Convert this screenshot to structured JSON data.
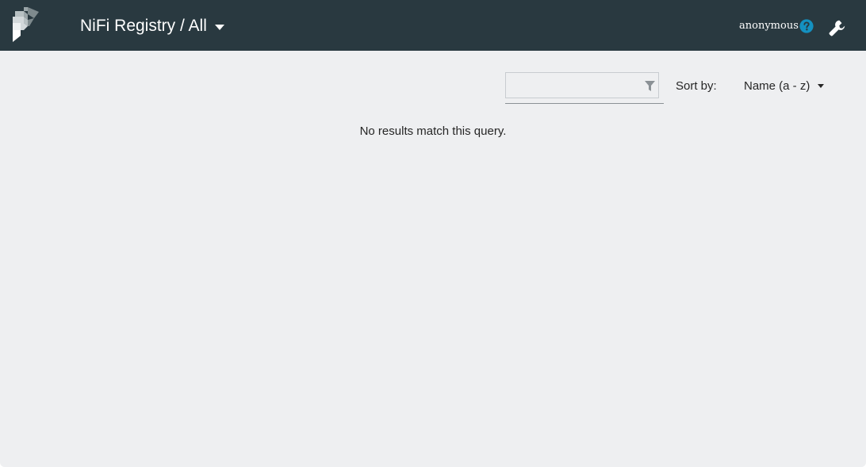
{
  "header": {
    "title": "NiFi Registry / All",
    "user": "anonymous",
    "logo_icon": "nifi-registry-logo-icon",
    "help_icon": "help-icon",
    "settings_icon": "wrench-icon",
    "colors": {
      "background": "#293940",
      "help": "#1491c1"
    }
  },
  "filter": {
    "value": "",
    "placeholder": "",
    "icon": "filter-icon"
  },
  "sort": {
    "label": "Sort by:",
    "value": "Name (a - z)"
  },
  "results": {
    "empty_message": "No results match this query."
  },
  "colors": {
    "page_background": "#eeeff1",
    "text": "#262626"
  }
}
